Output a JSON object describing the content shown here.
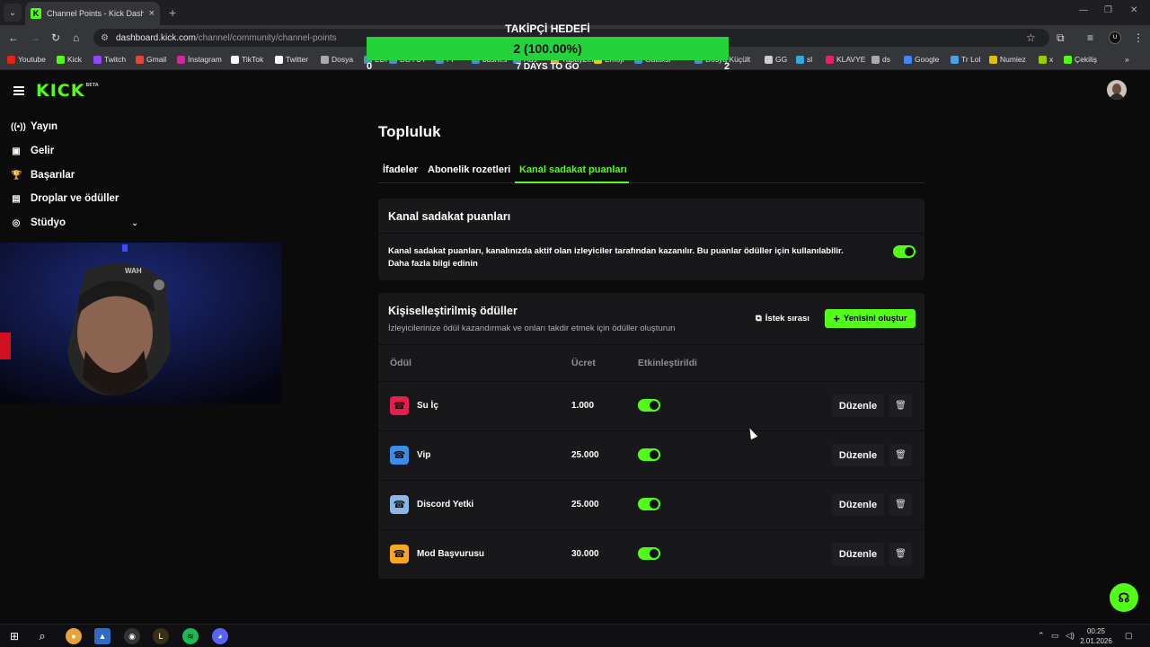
{
  "browser": {
    "tab_title": "Channel Points - Kick Dashboard",
    "url_host": "dashboard.kick.com",
    "url_path": "/channel/community/channel-points",
    "bookmarks": [
      "Youtube",
      "Kick",
      "Twitch",
      "Gmail",
      "İnstagram",
      "TikTok",
      "Twitter",
      "Dosya",
      "EDIT",
      "BOYUT",
      "FF",
      "bushes",
      "Ads",
      "YapayZeka",
      "Emoji",
      "Galaksi",
      "Dosya Küçült",
      "GG",
      "sl",
      "KLAVYE",
      "ds",
      "Google",
      "Tr Lol",
      "Numiez",
      "x",
      "Çekiliş"
    ]
  },
  "overlay": {
    "goal_title": "TAKİPÇİ HEDEFİ",
    "goal_text": "2 (100.00%)",
    "goal_progress": 1.0,
    "goal_min": "0",
    "goal_max": "2",
    "goal_days": "7 DAYS TO GO"
  },
  "sidebar": {
    "items": [
      {
        "label": "Yayın",
        "icon": "broadcast-icon"
      },
      {
        "label": "Gelir",
        "icon": "wallet-icon"
      },
      {
        "label": "Başarılar",
        "icon": "trophy-icon"
      },
      {
        "label": "Droplar ve ödüller",
        "icon": "gift-icon"
      },
      {
        "label": "Stüdyo",
        "icon": "studio-icon"
      }
    ]
  },
  "main": {
    "title": "Topluluk",
    "tabs": [
      "İfadeler",
      "Abonelik rozetleri",
      "Kanal sadakat puanları"
    ],
    "active_tab": 2,
    "loyalty_card": {
      "title": "Kanal sadakat puanları",
      "desc_line1": "Kanal sadakat puanları, kanalınızda aktif olan izleyiciler tarafından kazanılır. Bu puanlar ödüller için kullanılabilir.",
      "desc_line2": "Daha fazla bilgi edinin",
      "enabled": true
    },
    "rewards_card": {
      "title": "Kişiselleştirilmiş ödüller",
      "subtitle": "İzleyicilerinize ödül kazandırmak ve onları takdir etmek için ödüller oluşturun",
      "queue_button": "İstek sırası",
      "new_button": "Yenisini oluştur",
      "col_reward": "Ödül",
      "col_cost": "Ücret",
      "col_enabled": "Etkinleştirildi",
      "edit_label": "Düzenle",
      "rows": [
        {
          "name": "Su İç",
          "cost": "1.000",
          "color": "#e91e4b",
          "enabled": true
        },
        {
          "name": "Vip",
          "cost": "25.000",
          "color": "#3b8de8",
          "enabled": true
        },
        {
          "name": "Discord Yetki",
          "cost": "25.000",
          "color": "#8ab8e6",
          "enabled": true
        },
        {
          "name": "Mod Başvurusu",
          "cost": "30.000",
          "color": "#f5a623",
          "enabled": true
        }
      ]
    }
  },
  "taskbar": {
    "time": "00:25",
    "date": "2.01.2026"
  },
  "colors": {
    "accent": "#53fc18",
    "background": "#0b0b0c",
    "card": "#18181b"
  }
}
